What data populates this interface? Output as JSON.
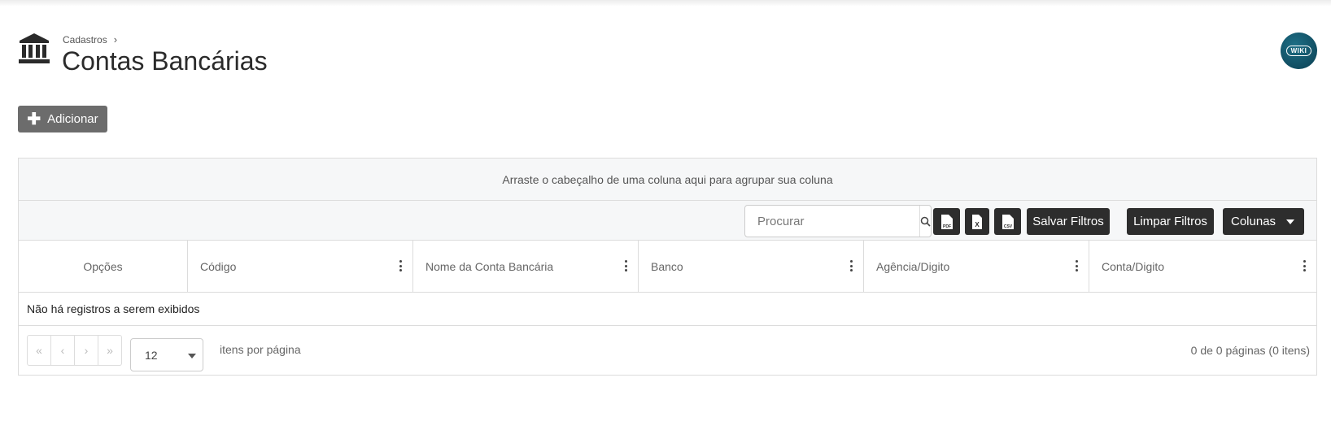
{
  "header": {
    "breadcrumb": "Cadastros",
    "breadcrumb_sep": "›",
    "title": "Contas Bancárias",
    "icon": "bank-icon",
    "wiki_label": "WIKI"
  },
  "actions": {
    "add_label": "Adicionar"
  },
  "grid": {
    "group_hint": "Arraste o cabeçalho de uma coluna aqui para agrupar sua coluna",
    "search_placeholder": "Procurar",
    "export_icons": [
      "pdf-file-icon",
      "excel-file-icon",
      "csv-file-icon"
    ],
    "export_labels": [
      "PDF",
      "X",
      "CSV"
    ],
    "save_filters": "Salvar Filtros",
    "clear_filters": "Limpar Filtros",
    "columns_button": "Colunas",
    "columns": [
      "Opções",
      "Código",
      "Nome da Conta Bancária",
      "Banco",
      "Agência/Digito",
      "Conta/Digito"
    ],
    "no_records": "Não há registros a serem exibidos"
  },
  "pager": {
    "first": "«",
    "prev": "‹",
    "next": "›",
    "last": "»",
    "page_size": "12",
    "items_per_page": "itens por página",
    "info": "0 de 0 páginas (0 itens)"
  }
}
